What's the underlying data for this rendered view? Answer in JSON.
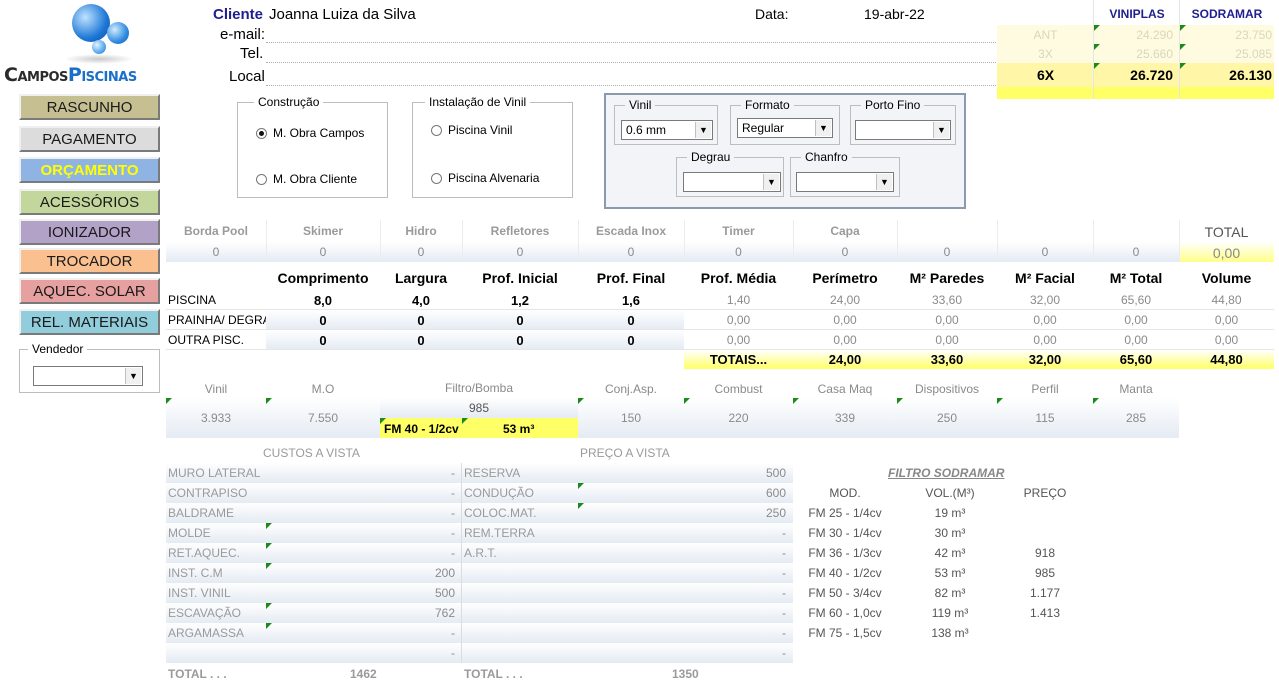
{
  "logo": {
    "text_a": "Campos",
    "text_b": "Piscinas"
  },
  "nav": {
    "buttons": [
      {
        "label": "RASCUNHO",
        "bg": "#c6bf92",
        "color": "#1a1a1a"
      },
      {
        "label": "PAGAMENTO",
        "bg": "#dcdcdc",
        "color": "#1a1a1a"
      },
      {
        "label": "ORÇAMENTO",
        "bg": "#8fb4e3",
        "color": "#ffff00"
      },
      {
        "label": "ACESSÓRIOS",
        "bg": "#c3d69b",
        "color": "#1a1a1a"
      },
      {
        "label": "IONIZADOR",
        "bg": "#b3a2c7",
        "color": "#1a1a1a"
      },
      {
        "label": "TROCADOR",
        "bg": "#fac090",
        "color": "#1a1a1a"
      },
      {
        "label": "AQUEC. SOLAR",
        "bg": "#e6a0a0",
        "color": "#1a1a1a"
      },
      {
        "label": "REL. MATERIAIS",
        "bg": "#92cddc",
        "color": "#1a1a1a"
      }
    ],
    "vendedor_label": "Vendedor",
    "vendedor_value": ""
  },
  "client": {
    "cliente_label": "Cliente",
    "cliente_value": "Joanna Luiza da Silva",
    "data_label": "Data:",
    "data_value": "19-abr-22",
    "email_label": "e-mail:",
    "email_value": "",
    "tel_label": "Tel.",
    "tel_value": "",
    "local_label": "Local",
    "local_value": ""
  },
  "prices": {
    "col1": "VINIPLAS",
    "col2": "SODRAMAR",
    "rows": [
      {
        "label": "ANT",
        "v1": "24.290",
        "v2": "23.750"
      },
      {
        "label": "3X",
        "v1": "25.660",
        "v2": "25.085"
      },
      {
        "label": "6X",
        "v1": "26.720",
        "v2": "26.130"
      }
    ]
  },
  "construcao": {
    "legend": "Construção",
    "options": [
      {
        "label": "M. Obra Campos",
        "checked": true
      },
      {
        "label": "M. Obra Cliente",
        "checked": false
      }
    ]
  },
  "instalacao": {
    "legend": "Instalação de Vinil",
    "options": [
      {
        "label": "Piscina Vinil",
        "checked": false
      },
      {
        "label": "Piscina Alvenaria",
        "checked": false
      }
    ]
  },
  "selectors": {
    "vinil": {
      "legend": "Vinil",
      "value": "0.6 mm"
    },
    "formato": {
      "legend": "Formato",
      "value": "Regular"
    },
    "porto_fino": {
      "legend": "Porto Fino",
      "value": ""
    },
    "degrau": {
      "legend": "Degrau",
      "value": ""
    },
    "chanfro": {
      "legend": "Chanfro",
      "value": ""
    }
  },
  "accessories": {
    "headers": [
      "Borda Pool",
      "Skimer",
      "Hidro",
      "Refletores",
      "Escada Inox",
      "Timer",
      "Capa",
      "",
      "",
      "",
      "TOTAL"
    ],
    "values": [
      "0",
      "0",
      "0",
      "0",
      "0",
      "0",
      "0",
      "0",
      "0",
      "0",
      "0,00"
    ]
  },
  "dimensions": {
    "headers": [
      "",
      "Comprimento",
      "Largura",
      "Prof. Inicial",
      "Prof. Final",
      "Prof. Média",
      "Perímetro",
      "M² Paredes",
      "M² Facial",
      "M² Total",
      "Volume"
    ],
    "rows": [
      [
        "PISCINA",
        "8,0",
        "4,0",
        "1,2",
        "1,6",
        "1,40",
        "24,00",
        "33,60",
        "32,00",
        "65,60",
        "44,80"
      ],
      [
        "PRAINHA/ DEGRAU",
        "0",
        "0",
        "0",
        "0",
        "0,00",
        "0,00",
        "0,00",
        "0,00",
        "0,00",
        "0,00"
      ],
      [
        "OUTRA PISC.",
        "0",
        "0",
        "0",
        "0",
        "0,00",
        "0,00",
        "0,00",
        "0,00",
        "0,00",
        "0,00"
      ]
    ],
    "totals_label": "TOTAIS...",
    "totals": [
      "24,00",
      "33,60",
      "32,00",
      "65,60",
      "44,80"
    ]
  },
  "components": {
    "headers": [
      "Vinil",
      "M.O",
      "Filtro/Bomba",
      "Conj.Asp.",
      "Combust",
      "Casa Maq",
      "Dispositivos",
      "Perfil",
      "Manta"
    ],
    "values": [
      "3.933",
      "7.550",
      "985",
      "150",
      "220",
      "339",
      "250",
      "115",
      "285"
    ],
    "filtro_model": "FM 40 - 1/2cv",
    "filtro_vol": "53 m³"
  },
  "custos": {
    "title": "CUSTOS A VISTA",
    "items": [
      {
        "label": "MURO LATERAL",
        "value": "-"
      },
      {
        "label": "CONTRAPISO",
        "value": "-"
      },
      {
        "label": "BALDRAME",
        "value": "-"
      },
      {
        "label": "MOLDE",
        "value": "-"
      },
      {
        "label": "RET.AQUEC.",
        "value": "-"
      },
      {
        "label": "INST. C.M",
        "value": "200"
      },
      {
        "label": "INST. VINIL",
        "value": "500"
      },
      {
        "label": "ESCAVAÇÃO",
        "value": "762"
      },
      {
        "label": "ARGAMASSA",
        "value": "-"
      },
      {
        "label": "",
        "value": "-"
      }
    ],
    "total_label": "TOTAL . . .",
    "total_value": "1462"
  },
  "precos": {
    "title": "PREÇO A VISTA",
    "items": [
      {
        "label": "RESERVA",
        "value": "500"
      },
      {
        "label": "CONDUÇÃO",
        "value": "600"
      },
      {
        "label": "COLOC.MAT.",
        "value": "250"
      },
      {
        "label": "REM.TERRA",
        "value": "-"
      },
      {
        "label": "A.R.T.",
        "value": "-"
      },
      {
        "label": "",
        "value": "-"
      },
      {
        "label": "",
        "value": "-"
      },
      {
        "label": "",
        "value": "-"
      },
      {
        "label": "",
        "value": "-"
      },
      {
        "label": "",
        "value": "-"
      }
    ],
    "total_label": "TOTAL . . .",
    "total_value": "1350"
  },
  "filtro": {
    "title": "FILTRO SODRAMAR",
    "headers": [
      "MOD.",
      "VOL.(M³)",
      "PREÇO"
    ],
    "rows": [
      [
        "FM 25 - 1/4cv",
        "19 m³",
        ""
      ],
      [
        "FM 30 - 1/4cv",
        "30 m³",
        ""
      ],
      [
        "FM 36 - 1/3cv",
        "42 m³",
        "918"
      ],
      [
        "FM 40 - 1/2cv",
        "53 m³",
        "985"
      ],
      [
        "FM 50 - 3/4cv",
        "82 m³",
        "1.177"
      ],
      [
        "FM 60 - 1,0cv",
        "119 m³",
        "1.413"
      ],
      [
        "FM 75 - 1,5cv",
        "138 m³",
        ""
      ]
    ]
  }
}
